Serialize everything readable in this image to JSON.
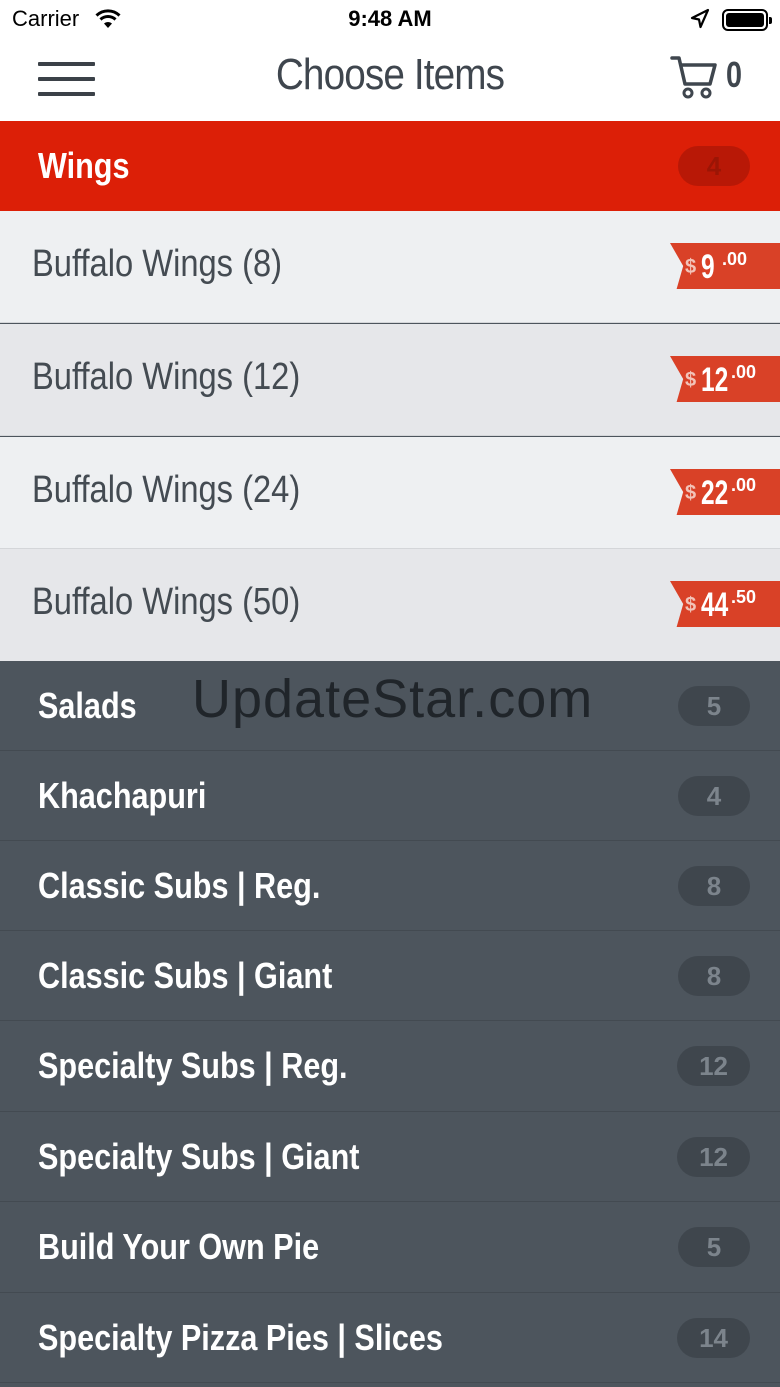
{
  "status_bar": {
    "carrier": "Carrier",
    "time": "9:48 AM"
  },
  "nav": {
    "title": "Choose Items",
    "cart_count": "0"
  },
  "categories_top": [
    {
      "label": "Wings",
      "count": "4"
    }
  ],
  "items": [
    {
      "name": "Buffalo Wings (8)",
      "currency": "$",
      "whole": "9",
      "cents": ".00"
    },
    {
      "name": "Buffalo Wings (12)",
      "currency": "$",
      "whole": "12",
      "cents": ".00"
    },
    {
      "name": "Buffalo Wings (24)",
      "currency": "$",
      "whole": "22",
      "cents": ".00"
    },
    {
      "name": "Buffalo Wings (50)",
      "currency": "$",
      "whole": "44",
      "cents": ".50"
    }
  ],
  "categories": [
    {
      "label": "Salads",
      "count": "5"
    },
    {
      "label": "Khachapuri",
      "count": "4"
    },
    {
      "label": "Classic Subs | Reg.",
      "count": "8"
    },
    {
      "label": "Classic Subs | Giant",
      "count": "8"
    },
    {
      "label": "Specialty Subs | Reg.",
      "count": "12"
    },
    {
      "label": "Specialty Subs | Giant",
      "count": "12"
    },
    {
      "label": "Build Your Own Pie",
      "count": "5"
    },
    {
      "label": "Specialty Pizza Pies | Slices",
      "count": "14"
    }
  ],
  "watermark": "UpdateStar.com",
  "colors": {
    "active_category": "#dc1f07",
    "category_bg": "#4d555d",
    "price_tag": "#d94127",
    "nav_bg": "#ffffff"
  },
  "icons": {
    "menu": "hamburger-icon",
    "cart": "cart-icon",
    "wifi": "wifi-icon",
    "location": "location-arrow-icon",
    "battery": "battery-icon"
  }
}
